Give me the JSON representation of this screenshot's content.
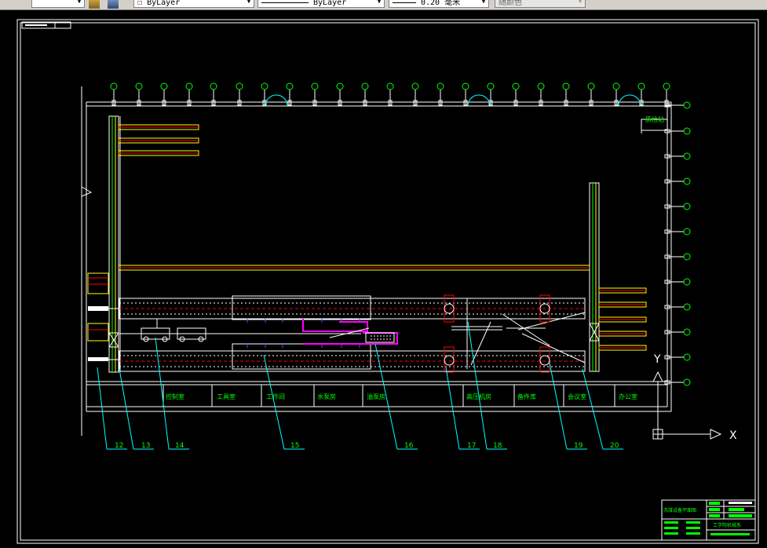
{
  "toolbar": {
    "linetype_value": "ByLayer",
    "lineweight_value": "ByLayer",
    "lineweight_mm": "0.20 毫米",
    "color_value": "随颜色",
    "layer_checkbox_symbol": "☐"
  },
  "drawing": {
    "room_labels": [
      "控制室",
      "工具室",
      "工作间",
      "水泵房",
      "油泵房",
      "高压机房",
      "备件库",
      "会议室",
      "办公室"
    ],
    "top_right_label": "质检站",
    "leader_numbers": [
      "12",
      "13",
      "14",
      "15",
      "16",
      "17",
      "18",
      "19",
      "20"
    ],
    "axis_x_label": "X",
    "axis_y_label": "Y",
    "title_block": {
      "drawing_title": "洗煤设备平面图",
      "org_name": "工学院机械系"
    },
    "colors": {
      "background": "#000000",
      "wall": "#ffffff",
      "grid": "#00ff00",
      "leader": "#00ffff",
      "pipe": "#ff00ff",
      "rail": "#ffff00",
      "red": "#ff0000"
    }
  }
}
